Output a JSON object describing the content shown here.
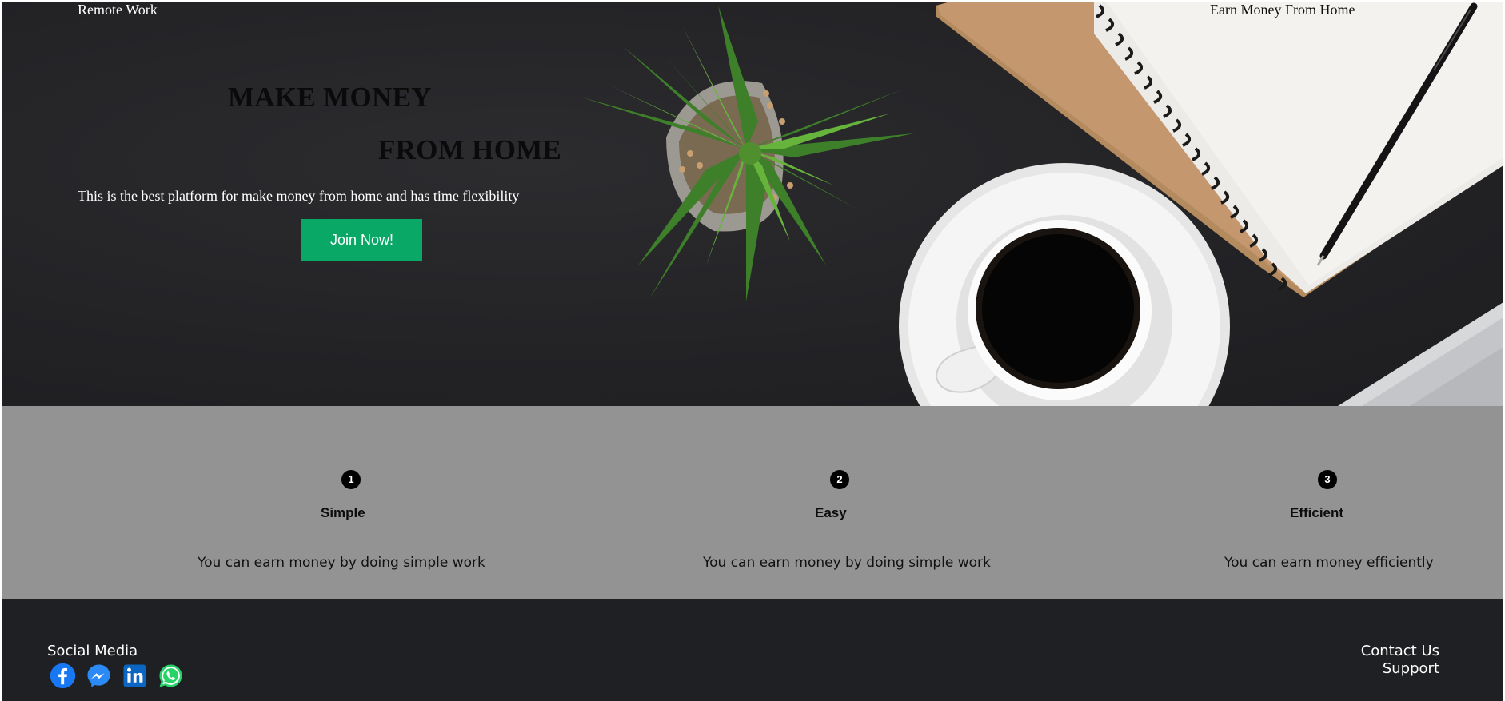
{
  "header": {
    "nav_left": "Remote Work",
    "nav_right": "Earn Money From Home"
  },
  "hero": {
    "title_line1": "MAKE MONEY",
    "title_line2": "FROM HOME",
    "tagline": "This is the best platform for make money from home and has time flexibility",
    "cta_label": "Join Now!",
    "background_color": "#232326",
    "cta_color": "#0aa867",
    "decor_icons": [
      "succulent-plant-icon",
      "coffee-cup-icon",
      "spiral-notebook-icon",
      "pen-icon",
      "laptop-icon"
    ]
  },
  "features": {
    "background_color": "#939393",
    "items": [
      {
        "number": "1",
        "title": "Simple",
        "description": "You can earn money by doing simple work"
      },
      {
        "number": "2",
        "title": "Easy",
        "description": "You can earn money by doing simple work"
      },
      {
        "number": "3",
        "title": "Efficient",
        "description": "You can earn money efficiently"
      }
    ]
  },
  "footer": {
    "background_color": "#1f2023",
    "social_label": "Social Media",
    "social_icons": [
      "facebook-icon",
      "messenger-icon",
      "linkedin-icon",
      "whatsapp-icon"
    ],
    "links": [
      "Contact Us",
      "Support"
    ]
  }
}
